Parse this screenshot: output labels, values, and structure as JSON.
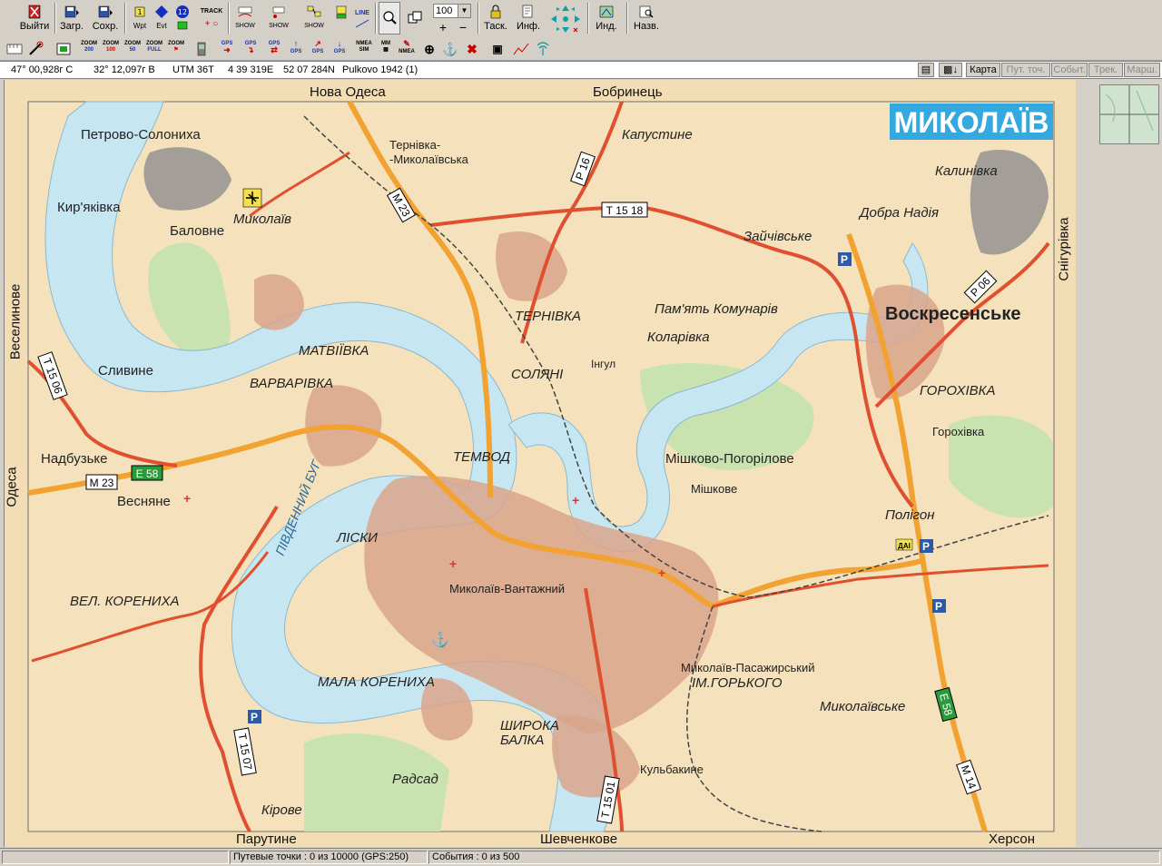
{
  "toolbar": {
    "exit": "Выйти",
    "load": "Загр.",
    "save": "Сохр.",
    "wpt": "Wpt",
    "evt": "Evt",
    "num12": "12",
    "track": "TRACK",
    "show1": "SHOW",
    "show2": "SHOW",
    "show3": "SHOW",
    "line": "LINE",
    "zoom_value": "100",
    "task": "Таск.",
    "info": "Инф.",
    "ind": "Инд.",
    "names": "Назв."
  },
  "toolbar2": {
    "zoom200": "200",
    "zoom100": "100",
    "zoom50": "50",
    "zoomfull": "FULL",
    "zoom": "ZOOM",
    "gps": "GPS",
    "nmea_sim": "SIM",
    "nmea": "NMEA",
    "mm": "MM"
  },
  "coords": {
    "lat": "47° 00,928г С",
    "lon": "32° 12,097г В",
    "utm": "UTM  36T",
    "easting": "4 39 319E",
    "northing": "52 07 284N",
    "datum": "Pulkovo 1942 (1)"
  },
  "tabs": [
    {
      "label": "Карта",
      "enabled": true
    },
    {
      "label": "Пут. точ.",
      "enabled": false
    },
    {
      "label": "Событ.",
      "enabled": false
    },
    {
      "label": "Трек.",
      "enabled": false
    },
    {
      "label": "Марш.",
      "enabled": false
    }
  ],
  "status": {
    "waypoints": "Путевые точки : 0 из 10000  (GPS:250)",
    "events": "События : 0 из 500"
  },
  "map": {
    "title": "МИКОЛАЇВ",
    "edges": {
      "top1": "Нова Одеса",
      "top2": "Бобринець",
      "left1": "Веселинове",
      "left2": "Одеса",
      "right": "Снігурівка",
      "bottom1": "Парутине",
      "bottom2": "Шевченкове",
      "bottom3": "Херсон"
    },
    "places": {
      "petrovo": "Петрово-Солониха",
      "kiryakivka": "Кир'яківка",
      "balovne": "Баловне",
      "mykolaiv_airport": "Миколаїв",
      "ternivka_mykolaivska": "Тернівка-\n-Миколаївська",
      "kapustyne": "Капустине",
      "kalynivka": "Калинівка",
      "dobra_nadia": "Добра Надія",
      "zaichivske": "Зайчівське",
      "voskresenske": "Воскресенське",
      "ternivka": "ТЕРНІВКА",
      "pamiat": "Пам'ять Комунарів",
      "kolarivka": "Коларівка",
      "matviivka": "МАТВІЇВКА",
      "solyani": "СОЛЯНІ",
      "inhul": "Інгул",
      "varvarivka": "ВАРВАРІВКА",
      "slyvyne": "Сливине",
      "horokhivka_u": "ГОРОХІВКА",
      "horokhivka": "Горохівка",
      "nadbuzke": "Надбузьке",
      "temvod": "ТЕМВОД",
      "mishkovo": "Мішково-Погорілове",
      "mishkove": "Мішкове",
      "vesniane": "Весняне",
      "polihon": "Полігон",
      "lisky": "ЛІСКИ",
      "pivdennyi_buh": "ПІВДЕННИЙ БУГ",
      "vel_korenykha": "ВЕЛ. КОРЕНИХА",
      "vantazhnyi": "Миколаїв-Вантажний",
      "pasazhyrskyi": "Миколаїв-Пасажирський",
      "horkoho": "ІМ.ГОРЬКОГО",
      "mala_korenykha": "МАЛА КОРЕНИХА",
      "mykolaivske": "Миколаївське",
      "shyroka": "ШИРОКА\nБАЛКА",
      "kulbakyne": "Кульбакине",
      "radsad": "Радсад",
      "kirove": "Кірове"
    },
    "road_labels": {
      "m23a": "М 23",
      "m23b": "М 23",
      "e58a": "Е 58",
      "e58b": "Е 58",
      "r16": "Р 16",
      "t1518": "Т 15 18",
      "r06": "Р 06",
      "t1506": "Т 15 06",
      "t1507": "Т 15 07",
      "t1501": "Т 15 01",
      "m14": "М 14",
      "p": "P",
      "dai": "ДАІ"
    },
    "colors": {
      "land": "#f2ddb4",
      "water": "#c6e6f2",
      "forest": "#c9e3b0",
      "urban": "#d9a58c",
      "highway": "#f2a230",
      "main_road": "#e0502e",
      "title_bg": "#33a9e0"
    }
  }
}
